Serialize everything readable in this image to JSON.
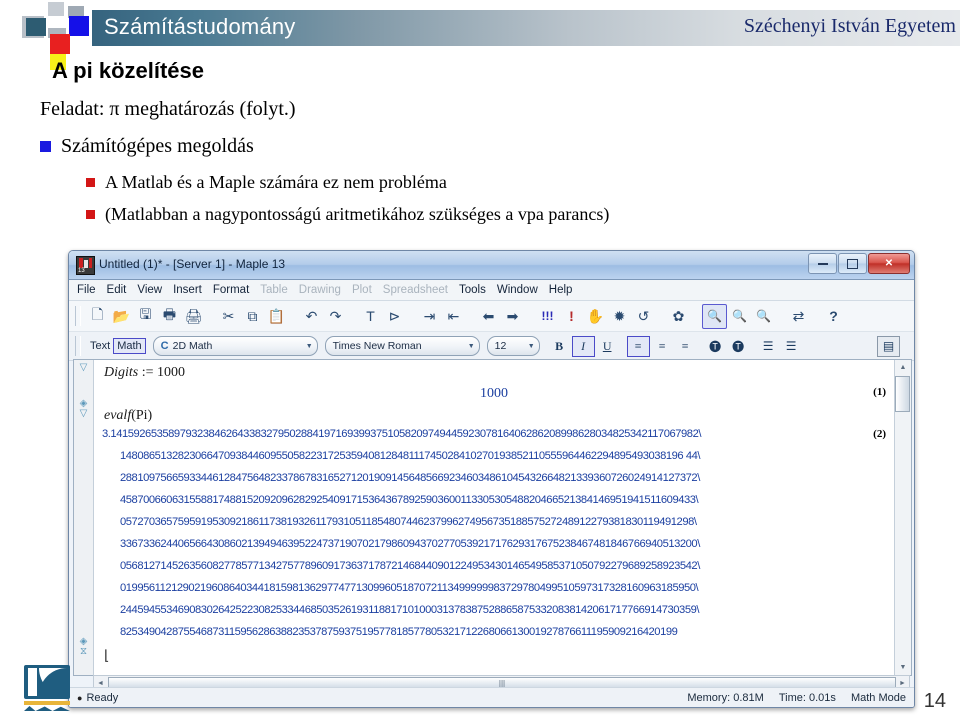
{
  "slide": {
    "header": {
      "topic": "Számítástudomány",
      "university": "Széchenyi István Egyetem"
    },
    "title": "A pi közelítése",
    "lead": "Feladat: π meghatározás (folyt.)",
    "bullets": [
      {
        "level": 1,
        "text": "Számítógépes megoldás",
        "marker_color": "#1a1ae0"
      },
      {
        "level": 2,
        "text": "A Matlab és a Maple számára ez nem probléma",
        "marker_color": "#d31616"
      },
      {
        "level": 2,
        "text": "(Matlabban a nagypontosságú aritmetikához szükséges a vpa parancs)",
        "marker_color": "#d31616"
      }
    ],
    "page_number": "14"
  },
  "maple": {
    "title_bar": {
      "title": "Untitled (1)* - [Server 1] - Maple 13",
      "app_icon": "maple-icon",
      "buttons": [
        {
          "name": "minimize-button",
          "glyph": "minimize-icon"
        },
        {
          "name": "maximize-button",
          "glyph": "maximize-icon"
        },
        {
          "name": "close-button",
          "glyph": "close-icon",
          "label": "✕"
        }
      ]
    },
    "menu": [
      {
        "label": "File",
        "enabled": true
      },
      {
        "label": "Edit",
        "enabled": true
      },
      {
        "label": "View",
        "enabled": true
      },
      {
        "label": "Insert",
        "enabled": true
      },
      {
        "label": "Format",
        "enabled": true
      },
      {
        "label": "Table",
        "enabled": false
      },
      {
        "label": "Drawing",
        "enabled": false
      },
      {
        "label": "Plot",
        "enabled": false
      },
      {
        "label": "Spreadsheet",
        "enabled": false
      },
      {
        "label": "Tools",
        "enabled": true
      },
      {
        "label": "Window",
        "enabled": true
      },
      {
        "label": "Help",
        "enabled": true
      }
    ],
    "toolbar": [
      {
        "name": "new-icon",
        "glyph": "🗋"
      },
      {
        "name": "open-icon",
        "glyph": "📂"
      },
      {
        "name": "save-icon",
        "glyph": "🖫"
      },
      {
        "name": "print-icon",
        "glyph": "🖶"
      },
      {
        "name": "print-preview-icon",
        "glyph": "🖨"
      },
      {
        "name": "cut-icon",
        "glyph": "✂"
      },
      {
        "name": "copy-icon",
        "glyph": "⧉"
      },
      {
        "name": "paste-icon",
        "glyph": "📋"
      },
      {
        "name": "undo-icon",
        "glyph": "↶"
      },
      {
        "name": "redo-icon",
        "glyph": "↷"
      },
      {
        "name": "text-mode-icon",
        "glyph": "T"
      },
      {
        "name": "math-prompt-icon",
        "glyph": "⊳"
      },
      {
        "name": "indent-right-icon",
        "glyph": "⇥"
      },
      {
        "name": "indent-left-icon",
        "glyph": "⇤"
      },
      {
        "name": "navigate-back-icon",
        "glyph": "⬅"
      },
      {
        "name": "navigate-forward-icon",
        "glyph": "➡"
      },
      {
        "name": "execute-all-icon",
        "glyph": "!!!"
      },
      {
        "name": "execute-icon",
        "glyph": "!"
      },
      {
        "name": "stop-icon",
        "glyph": "✋"
      },
      {
        "name": "debug-icon",
        "glyph": "✹"
      },
      {
        "name": "restart-icon",
        "glyph": "↺"
      },
      {
        "name": "options-icon",
        "glyph": "✿"
      },
      {
        "name": "zoom-select-icon",
        "glyph": "🔍",
        "selected": true
      },
      {
        "name": "zoom-in-icon",
        "glyph": "🔍"
      },
      {
        "name": "zoom-out-icon",
        "glyph": "🔍"
      },
      {
        "name": "toggle-input-icon",
        "glyph": "⇄"
      },
      {
        "name": "help-icon",
        "glyph": "?"
      }
    ],
    "format_bar": {
      "mode_text_label": "Text",
      "mode_math_label": "Math",
      "mode_selected": "Math",
      "style_combo": {
        "value": "2D Math",
        "icon": "C"
      },
      "font_combo": {
        "value": "Times New Roman"
      },
      "size_combo": {
        "value": "12"
      },
      "bold_label": "B",
      "italic_label": "I",
      "underline_label": "U",
      "align_left_icon": "align-left-icon",
      "align_center_icon": "align-center-icon",
      "align_right_icon": "align-right-icon",
      "text_color_icon": "text-color-icon",
      "highlight_color_icon": "highlight-color-icon",
      "bullet_list_icon": "bullet-list-icon",
      "numbered_list_icon": "numbered-list-icon",
      "panel_toggle_icon": "document-panel-icon",
      "italic_selected": true,
      "align_left_selected": true
    },
    "document": {
      "statements": [
        {
          "kind": "input",
          "italic": "Digits",
          "op": " := ",
          "value": "1000"
        },
        {
          "kind": "output",
          "value": "1000",
          "label": "(1)"
        },
        {
          "kind": "input",
          "italic": "evalf",
          "op": "",
          "value": "(Pi)"
        }
      ],
      "pi_label": "(2)",
      "pi_lines": [
        "3.141592653589793238462643383279502884197169399375105820974944592307816406286208998628034825342117067982\\",
        "14808651328230664709384460955058223172535940812848111745028410270193852110555964462294895493038196 44\\",
        "2881097566593344612847564823378678316527120190914564856692346034861045432664821339360726024914127372\\",
        "4587006606315588174881520920962829254091715364367892590360011330530548820466521384146951941511609433\\",
        "0572703657595919530921861173819326117931051185480744623799627495673518857527248912279381830119491298\\",
        "3367336244065664308602139494639522473719070217986094370277053921717629317675238467481846766940513200\\",
        "0568127145263560827785771342757789609173637178721468440901224953430146549585371050792279689258923542\\",
        "0199561121290219608640344181598136297747713099605187072113499999983729780499510597317328160963185950\\",
        "2445945534690830264252230825334468503526193118817101000313783875288658753320838142061717766914730359\\",
        "8253490428755468731159562863882353787593751957781857780532171226806613001927876611195909216420199"
      ]
    },
    "status": {
      "ready": "Ready",
      "memory": "Memory: 0.81M",
      "time": "Time: 0.01s",
      "mode": "Math Mode"
    }
  }
}
